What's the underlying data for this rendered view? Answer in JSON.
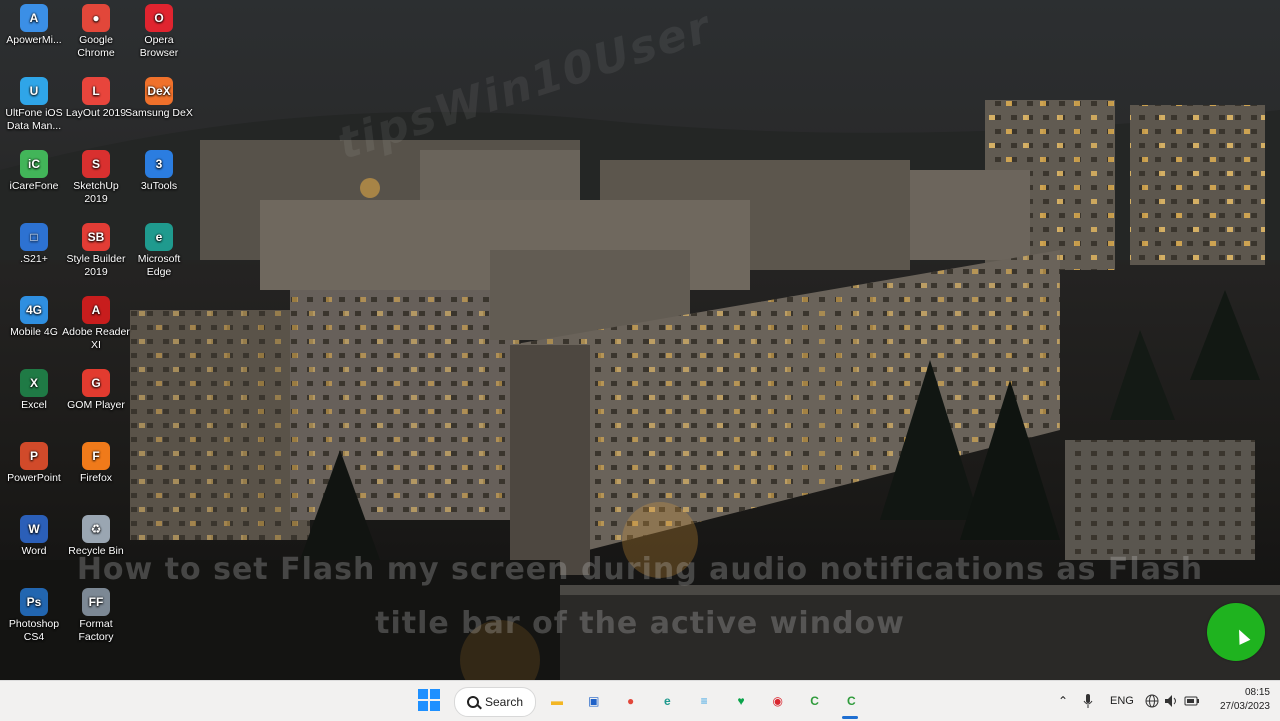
{
  "wallpaper": {
    "watermark": "tipsWin10User",
    "caption_line1": "How to set Flash my screen during audio notifications as Flash",
    "caption_line2": "title bar of the active window"
  },
  "desktop_icons": [
    {
      "label": "ApowerMi...",
      "icon": "apowermirror-icon",
      "color": "#3b8fe6",
      "glyph": "A"
    },
    {
      "label": "Google Chrome",
      "icon": "chrome-icon",
      "color": "#e2473a",
      "glyph": "●"
    },
    {
      "label": "Opera Browser",
      "icon": "opera-icon",
      "color": "#e0242f",
      "glyph": "O"
    },
    {
      "label": "UltFone iOS Data Man...",
      "icon": "ultfone-icon",
      "color": "#2fa5e8",
      "glyph": "U"
    },
    {
      "label": "LayOut 2019",
      "icon": "layout-icon",
      "color": "#e8453c",
      "glyph": "L"
    },
    {
      "label": "Samsung DeX",
      "icon": "samsung-dex-icon",
      "color": "#f0712b",
      "glyph": "DeX"
    },
    {
      "label": "iCareFone",
      "icon": "icarefone-icon",
      "color": "#42b559",
      "glyph": "iC"
    },
    {
      "label": "SketchUp 2019",
      "icon": "sketchup-icon",
      "color": "#d9302f",
      "glyph": "S"
    },
    {
      "label": "3uTools",
      "icon": "3utools-icon",
      "color": "#2b7de0",
      "glyph": "3"
    },
    {
      "label": ".S21+",
      "icon": "folder-s21-icon",
      "color": "#2d72d2",
      "glyph": "□"
    },
    {
      "label": "Style Builder 2019",
      "icon": "style-builder-icon",
      "color": "#e23c35",
      "glyph": "SB"
    },
    {
      "label": "Microsoft Edge",
      "icon": "edge-icon",
      "color": "#1f9a8e",
      "glyph": "e"
    },
    {
      "label": "Mobile 4G",
      "icon": "mobile-4g-icon",
      "color": "#2f8fe0",
      "glyph": "4G"
    },
    {
      "label": "Adobe Reader XI",
      "icon": "adobe-reader-icon",
      "color": "#c81d1d",
      "glyph": "A"
    },
    {
      "label": "Excel",
      "icon": "excel-icon",
      "color": "#1f7a45",
      "glyph": "X"
    },
    {
      "label": "GOM Player",
      "icon": "gom-player-icon",
      "color": "#e23b2f",
      "glyph": "G"
    },
    {
      "label": "PowerPoint",
      "icon": "powerpoint-icon",
      "color": "#d14a2a",
      "glyph": "P"
    },
    {
      "label": "Firefox",
      "icon": "firefox-icon",
      "color": "#f07a1a",
      "glyph": "F"
    },
    {
      "label": "Word",
      "icon": "word-icon",
      "color": "#2b5fb8",
      "glyph": "W"
    },
    {
      "label": "Recycle Bin",
      "icon": "recycle-bin-icon",
      "color": "#9aa6b2",
      "glyph": "♻"
    },
    {
      "label": "Photoshop CS4",
      "icon": "photoshop-icon",
      "color": "#2266b0",
      "glyph": "Ps"
    },
    {
      "label": "Format Factory",
      "icon": "format-factory-icon",
      "color": "#7c8894",
      "glyph": "FF"
    }
  ],
  "taskbar": {
    "search_label": "Search",
    "apps": [
      {
        "name": "file-explorer-icon",
        "color": "#f3b623",
        "glyph": "▬"
      },
      {
        "name": "store-icon",
        "color": "#1f62c8",
        "glyph": "▣"
      },
      {
        "name": "chrome-taskbar-icon",
        "color": "#e2473a",
        "glyph": "●"
      },
      {
        "name": "edge-taskbar-icon",
        "color": "#1f9a8e",
        "glyph": "e"
      },
      {
        "name": "notepad-icon",
        "color": "#3aa3e3",
        "glyph": "≡"
      },
      {
        "name": "kaspersky-icon",
        "color": "#0aa34a",
        "glyph": "♥"
      },
      {
        "name": "media-app-icon",
        "color": "#d9262f",
        "glyph": "◉"
      },
      {
        "name": "camtasia-icon",
        "color": "#2f9b3b",
        "glyph": "C"
      },
      {
        "name": "camtasia-recorder-icon",
        "color": "#2f9b3b",
        "glyph": "C"
      }
    ],
    "tray": {
      "language": "ENG",
      "time": "08:15",
      "date": "27/03/2023"
    }
  }
}
